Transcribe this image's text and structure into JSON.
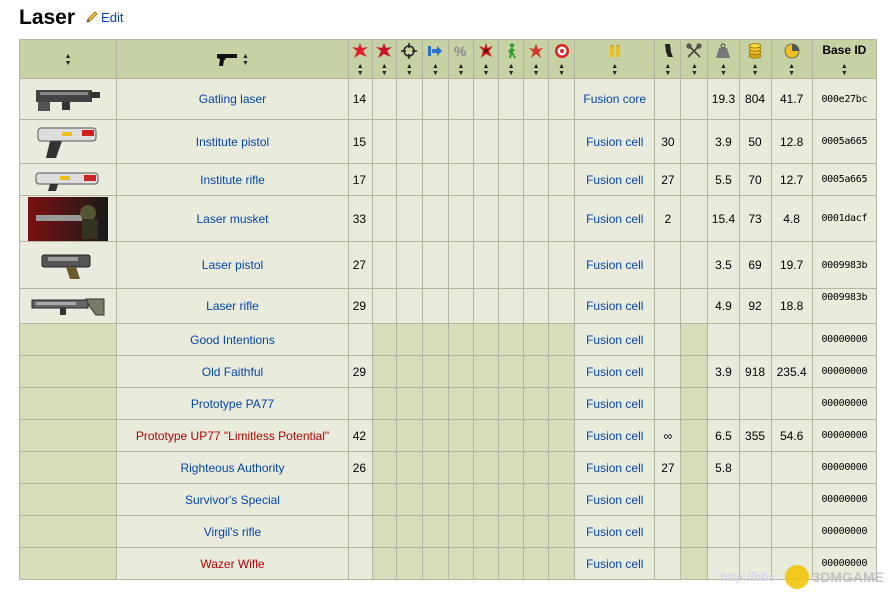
{
  "page": {
    "title": "Laser",
    "edit_label": "Edit"
  },
  "header_icons": {
    "weapon": "pistol-icon",
    "damage": "damage-burst-icon",
    "damage2": "damage-burst-icon",
    "accuracy": "crosshair-icon",
    "range": "arrow-right-icon",
    "crit": "percent-icon",
    "crit_dmg": "burst-icon",
    "ap": "running-man-icon",
    "burst": "explosion-icon",
    "target": "target-icon",
    "ammo": "ammo-icon",
    "magazine": "magazine-icon",
    "rate": "tools-icon",
    "weight": "weight-icon",
    "value": "coins-icon",
    "ratio": "pie-chart-icon"
  },
  "header_labels": {
    "base_id": "Base ID"
  },
  "rows": [
    {
      "img": true,
      "name": "Gatling laser",
      "red": false,
      "damage": "14",
      "ammo": "Fusion core",
      "mag": "",
      "weight": "19.3",
      "value": "804",
      "ratio": "41.7",
      "base_id": "000e27bc"
    },
    {
      "img": true,
      "name": "Institute pistol",
      "red": false,
      "damage": "15",
      "ammo": "Fusion cell",
      "mag": "30",
      "weight": "3.9",
      "value": "50",
      "ratio": "12.8",
      "base_id": "0005a665"
    },
    {
      "img": true,
      "name": "Institute rifle",
      "red": false,
      "damage": "17",
      "ammo": "Fusion cell",
      "mag": "27",
      "weight": "5.5",
      "value": "70",
      "ratio": "12.7",
      "base_id": "0005a665"
    },
    {
      "img": true,
      "name": "Laser musket",
      "red": false,
      "damage": "33",
      "ammo": "Fusion cell",
      "mag": "2",
      "weight": "15.4",
      "value": "73",
      "ratio": "4.8",
      "base_id": "0001dacf"
    },
    {
      "img": true,
      "name": "Laser pistol",
      "red": false,
      "damage": "27",
      "ammo": "Fusion cell",
      "mag": "",
      "weight": "3.5",
      "value": "69",
      "ratio": "19.7",
      "base_id": "0009983b"
    },
    {
      "img": true,
      "name": "Laser rifle",
      "red": false,
      "damage": "29",
      "ammo": "Fusion cell",
      "mag": "",
      "weight": "4.9",
      "value": "92",
      "ratio": "18.8",
      "base_id": "0009983b"
    },
    {
      "img": false,
      "name": "Good Intentions",
      "red": false,
      "damage": "",
      "ammo": "Fusion cell",
      "mag": "",
      "weight": "",
      "value": "",
      "ratio": "",
      "base_id": "00000000"
    },
    {
      "img": false,
      "name": "Old Faithful",
      "red": false,
      "damage": "29",
      "ammo": "Fusion cell",
      "mag": "",
      "weight": "3.9",
      "value": "918",
      "ratio": "235.4",
      "base_id": "00000000"
    },
    {
      "img": false,
      "name": "Prototype PA77",
      "red": false,
      "damage": "",
      "ammo": "Fusion cell",
      "mag": "",
      "weight": "",
      "value": "",
      "ratio": "",
      "base_id": "00000000"
    },
    {
      "img": false,
      "name": "Prototype UP77 \"Limitless Potential\"",
      "red": true,
      "damage": "42",
      "ammo": "Fusion cell",
      "mag": "∞",
      "weight": "6.5",
      "value": "355",
      "ratio": "54.6",
      "base_id": "00000000"
    },
    {
      "img": false,
      "name": "Righteous Authority",
      "red": false,
      "damage": "26",
      "ammo": "Fusion cell",
      "mag": "27",
      "weight": "5.8",
      "value": "",
      "ratio": "",
      "base_id": "00000000"
    },
    {
      "img": false,
      "name": "Survivor's Special",
      "red": false,
      "damage": "",
      "ammo": "Fusion cell",
      "mag": "",
      "weight": "",
      "value": "",
      "ratio": "",
      "base_id": "00000000"
    },
    {
      "img": false,
      "name": "Virgil's rifle",
      "red": false,
      "damage": "",
      "ammo": "Fusion cell",
      "mag": "",
      "weight": "",
      "value": "",
      "ratio": "",
      "base_id": "00000000"
    },
    {
      "img": false,
      "name": "Wazer Wifle",
      "red": true,
      "damage": "",
      "ammo": "Fusion cell",
      "mag": "",
      "weight": "",
      "value": "",
      "ratio": "",
      "base_id": "00000000"
    }
  ],
  "watermark": {
    "url": "http://bbs.",
    "brand": "3DMGAME"
  }
}
